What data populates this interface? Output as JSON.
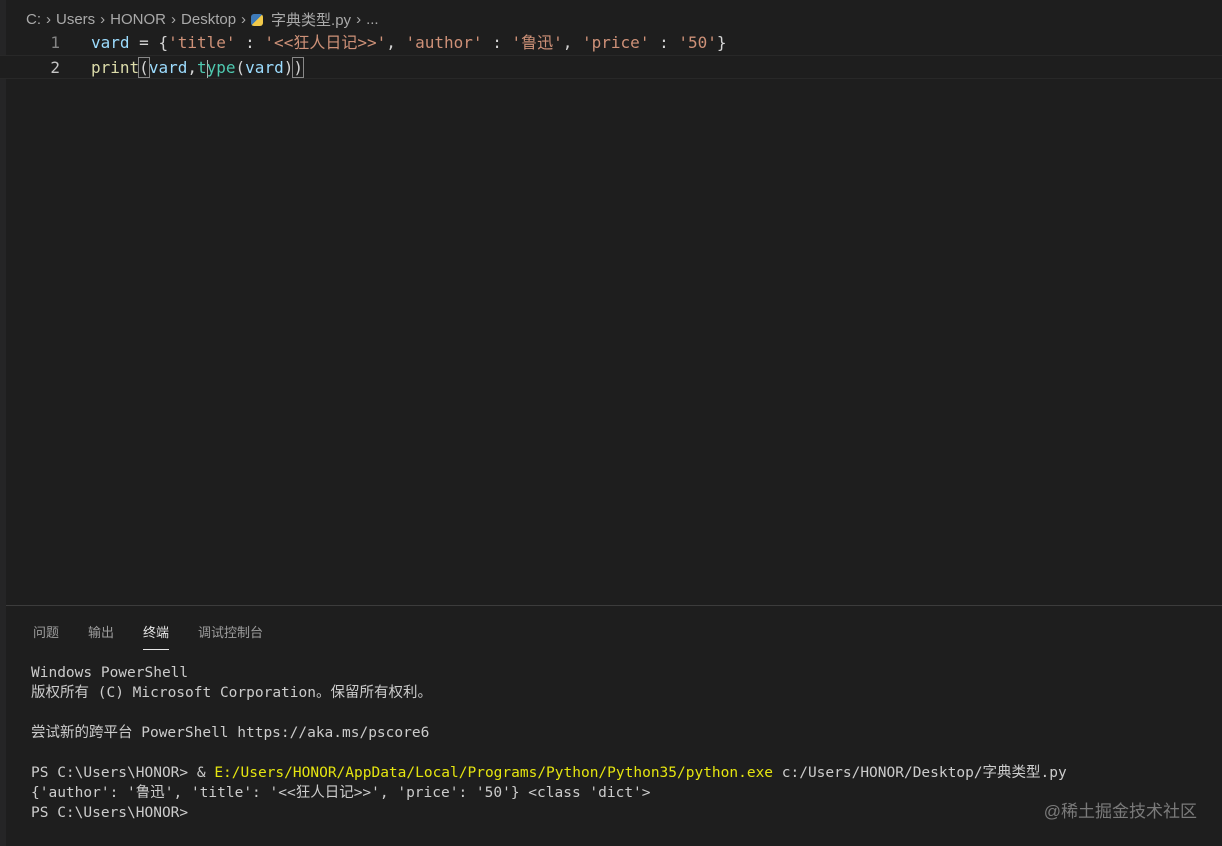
{
  "breadcrumb": {
    "items": [
      "C:",
      "Users",
      "HONOR",
      "Desktop"
    ],
    "file": "字典类型.py",
    "more": "..."
  },
  "editor": {
    "line_numbers": [
      "1",
      "2"
    ],
    "line1": {
      "var": "vard",
      "eq": " = ",
      "ob": "{",
      "k1": "'title'",
      "c1": " : ",
      "v1": "'<<狂人日记>>'",
      "cm1": ", ",
      "k2": "'author'",
      "c2": " : ",
      "v2": "'鲁迅'",
      "cm2": ", ",
      "k3": "'price'",
      "c3": " : ",
      "v3": "'50'",
      "cb": "}"
    },
    "line2": {
      "fn": "print",
      "op": "(",
      "a1": "vard",
      "comma": ",",
      "t1": "t",
      "t2": "ype",
      "op2": "(",
      "a2": "vard",
      "cp2": ")",
      "cp": ")"
    }
  },
  "panel": {
    "tabs": [
      "问题",
      "输出",
      "终端",
      "调试控制台"
    ],
    "active_tab": "终端"
  },
  "terminal": {
    "lines": [
      "Windows PowerShell",
      "版权所有 (C) Microsoft Corporation。保留所有权利。",
      "",
      "尝试新的跨平台 PowerShell https://aka.ms/pscore6",
      ""
    ],
    "cmd_prompt": "PS C:\\Users\\HONOR> & ",
    "cmd_exe": "E:/Users/HONOR/AppData/Local/Programs/Python/Python35/python.exe",
    "cmd_arg": " c:/Users/HONOR/Desktop/字典类型.py",
    "output": "{'author': '鲁迅', 'title': '<<狂人日记>>', 'price': '50'} <class 'dict'>",
    "prompt": "PS C:\\Users\\HONOR>"
  },
  "watermark": "@稀土掘金技术社区"
}
